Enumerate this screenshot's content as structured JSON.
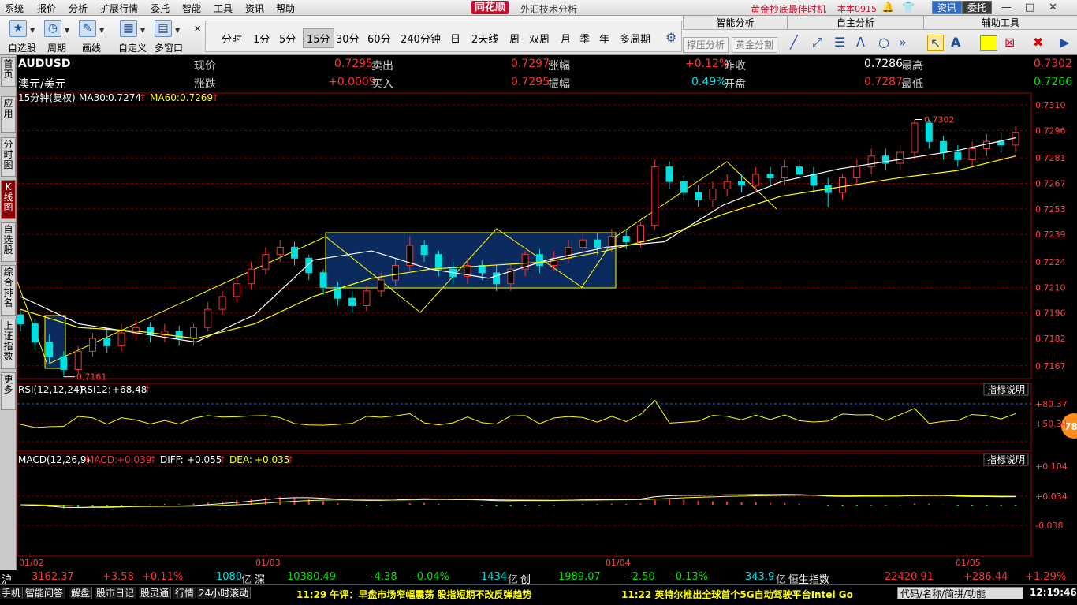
{
  "menu": {
    "items": [
      "系统",
      "报价",
      "分析",
      "扩展行情",
      "委托",
      "智能",
      "工具",
      "资讯",
      "帮助"
    ],
    "brand": "同花顺",
    "brand_sub": "外汇技术分析",
    "promo": "黄金抄底最佳时机",
    "user": "本本0915",
    "news_btn": "资讯",
    "trade_btn": "委托"
  },
  "toolbar": {
    "tools": [
      {
        "label": "自选股",
        "icon": "star"
      },
      {
        "label": "周期",
        "icon": "clock"
      },
      {
        "label": "画线",
        "icon": "pen"
      },
      {
        "label": "自定义",
        "icon": "grid"
      },
      {
        "label": "多窗口",
        "icon": "windows"
      }
    ],
    "periods": [
      "分时",
      "1分",
      "5分",
      "15分",
      "30分",
      "60分",
      "240分钟",
      "日",
      "2天线",
      "周",
      "双周",
      "月",
      "季",
      "年",
      "多周期"
    ],
    "active_period": "15分"
  },
  "right_panel": {
    "smart": "智能分析",
    "self": "自主分析",
    "aux": "辅助工具",
    "btn_support": "撑压分析",
    "btn_gold": "黄金分割"
  },
  "sidebar": {
    "tabs": [
      {
        "label": "首页",
        "active": false
      },
      {
        "label": "应用",
        "active": false
      },
      {
        "label": "分时图",
        "active": false
      },
      {
        "label": "K线图",
        "active": true
      },
      {
        "label": "自选股",
        "active": false
      },
      {
        "label": "综合排名",
        "active": false
      },
      {
        "label": "上证指数",
        "active": false
      },
      {
        "label": "更多",
        "active": false
      }
    ]
  },
  "quote": {
    "symbol": "AUDUSD",
    "name": "澳元/美元",
    "price_label": "现价",
    "price": "0.7295",
    "sell_label": "卖出",
    "sell": "0.7297",
    "pct_label": "涨幅",
    "pct": "+0.12%",
    "prev_label": "昨收",
    "prev": "0.7286",
    "high_label": "最高",
    "high": "0.7302",
    "chg_label": "涨跌",
    "chg": "+0.0009",
    "buy_label": "买入",
    "buy": "0.7295",
    "amp_label": "振幅",
    "amp": "0.49%",
    "open_label": "开盘",
    "open": "0.7287",
    "low_label": "最低",
    "low": "0.7266"
  },
  "main_chart": {
    "title": "15分钟(复权)",
    "ma30_label": "MA30:",
    "ma30": "0.7274",
    "ma60_label": "MA60:",
    "ma60": "0.7269",
    "high_mark": "0.7302",
    "low_mark": "0.7161",
    "yticks": [
      "0.7310",
      "0.7296",
      "0.7281",
      "0.7267",
      "0.7253",
      "0.7239",
      "0.7224",
      "0.7210",
      "0.7196",
      "0.7182",
      "0.7167"
    ]
  },
  "rsi": {
    "title": "RSI(12,12,24)",
    "label": "RSI12:",
    "value": "+68.48",
    "explain": "指标说明",
    "yticks": [
      "+80.37",
      "+50.34"
    ],
    "badge": "78"
  },
  "macd": {
    "title": "MACD(12,26,9)",
    "macd_label": "MACD:",
    "macd": "+0.039",
    "diff_label": "DIFF:",
    "diff": "+0.055",
    "dea_label": "DEA:",
    "dea": "+0.035",
    "explain": "指标说明",
    "yticks": [
      "+0.104",
      "+0.034",
      "-0.038"
    ]
  },
  "dates": [
    "01/02",
    "01/03",
    "01/04",
    "01/05"
  ],
  "market": {
    "sh_label": "沪",
    "sh": "3162.37",
    "sh_chg": "+3.58",
    "sh_pct": "+0.11%",
    "sh_amt": "1080",
    "unit1": "亿",
    "sz_label": "深",
    "sz": "10380.49",
    "sz_chg": "-4.38",
    "sz_pct": "-0.04%",
    "sz_amt": "1434",
    "unit2": "亿",
    "cy_label": "创",
    "cy": "1989.07",
    "cy_chg": "-2.50",
    "cy_pct": "-0.13%",
    "cy_amt": "343.9",
    "unit3": "亿",
    "hs_label": "恒生指数",
    "hs": "22420.91",
    "hs_chg": "+286.44",
    "hs_pct": "+1.29%"
  },
  "bottom": {
    "tabs": [
      "手机",
      "智能问答",
      "解盘",
      "股市日记",
      "股灵通",
      "行情",
      "24小时滚动"
    ],
    "news1": "11:29 午评：早盘市场窄幅震荡 股指短期不改反弹趋势",
    "news2": "11:22 英特尔推出全球首个5G自动驾驶平台Intel Go",
    "search": "代码/名称/简拼/功能",
    "clock": "12:19:46"
  },
  "colors": {
    "up": "#ff3232",
    "down": "#00e0e0",
    "ma_white": "#ffffff",
    "ma_yellow": "#ffff00",
    "box_fill": "#0b2a5e",
    "grid": "#7a0000"
  },
  "chart_data": {
    "type": "candlestick",
    "x_labels": [
      "01/02",
      "01/03",
      "01/04",
      "01/05"
    ],
    "ylim": [
      0.716,
      0.731
    ],
    "series": [
      {
        "name": "MA30",
        "values": [
          0.7205,
          0.719,
          0.7185,
          0.718,
          0.7195,
          0.7225,
          0.723,
          0.722,
          0.7215,
          0.7225,
          0.7232,
          0.7235,
          0.7255,
          0.7268,
          0.7275,
          0.728,
          0.7285,
          0.7292
        ]
      },
      {
        "name": "MA60",
        "values": [
          0.7198,
          0.7188,
          0.7186,
          0.7182,
          0.719,
          0.7205,
          0.7215,
          0.722,
          0.7222,
          0.7224,
          0.723,
          0.7238,
          0.725,
          0.726,
          0.7265,
          0.727,
          0.7274,
          0.7282
        ]
      }
    ],
    "candles": [
      [
        0.7195,
        0.719,
        0.7198,
        0.7186
      ],
      [
        0.719,
        0.718,
        0.7193,
        0.7176
      ],
      [
        0.718,
        0.7172,
        0.7184,
        0.7168
      ],
      [
        0.7172,
        0.7165,
        0.7175,
        0.7161
      ],
      [
        0.7165,
        0.7175,
        0.7178,
        0.7163
      ],
      [
        0.7175,
        0.7182,
        0.7185,
        0.7172
      ],
      [
        0.7182,
        0.7178,
        0.7188,
        0.7174
      ],
      [
        0.7178,
        0.7185,
        0.719,
        0.7175
      ],
      [
        0.7185,
        0.7188,
        0.7192,
        0.7182
      ],
      [
        0.7188,
        0.7184,
        0.7191,
        0.718
      ],
      [
        0.7184,
        0.7186,
        0.719,
        0.718
      ],
      [
        0.7186,
        0.7182,
        0.7189,
        0.7178
      ],
      [
        0.7182,
        0.7188,
        0.719,
        0.7178
      ],
      [
        0.7188,
        0.7198,
        0.7202,
        0.7186
      ],
      [
        0.7198,
        0.7205,
        0.7208,
        0.7195
      ],
      [
        0.7205,
        0.7212,
        0.7215,
        0.7202
      ],
      [
        0.7212,
        0.722,
        0.7224,
        0.7209
      ],
      [
        0.722,
        0.7228,
        0.7232,
        0.7217
      ],
      [
        0.7228,
        0.7232,
        0.7236,
        0.7224
      ],
      [
        0.7232,
        0.7226,
        0.7235,
        0.7222
      ],
      [
        0.7226,
        0.7218,
        0.7228,
        0.7214
      ],
      [
        0.7218,
        0.721,
        0.722,
        0.7206
      ],
      [
        0.721,
        0.7204,
        0.7213,
        0.72
      ],
      [
        0.7204,
        0.72,
        0.7208,
        0.7196
      ],
      [
        0.72,
        0.7208,
        0.7211,
        0.7197
      ],
      [
        0.7208,
        0.7214,
        0.7218,
        0.7205
      ],
      [
        0.7214,
        0.7222,
        0.7226,
        0.7211
      ],
      [
        0.7222,
        0.7233,
        0.7238,
        0.7219
      ],
      [
        0.7233,
        0.7228,
        0.7236,
        0.7224
      ],
      [
        0.7228,
        0.722,
        0.723,
        0.7216
      ],
      [
        0.722,
        0.7216,
        0.7224,
        0.7212
      ],
      [
        0.7216,
        0.7222,
        0.7226,
        0.7212
      ],
      [
        0.7222,
        0.7218,
        0.7225,
        0.7214
      ],
      [
        0.7218,
        0.7212,
        0.7222,
        0.7208
      ],
      [
        0.7212,
        0.722,
        0.7223,
        0.7208
      ],
      [
        0.722,
        0.7228,
        0.723,
        0.7216
      ],
      [
        0.7228,
        0.7222,
        0.7231,
        0.7218
      ],
      [
        0.7222,
        0.7226,
        0.723,
        0.7219
      ],
      [
        0.7226,
        0.7232,
        0.7236,
        0.7223
      ],
      [
        0.7232,
        0.7236,
        0.724,
        0.7229
      ],
      [
        0.7236,
        0.7232,
        0.724,
        0.7228
      ],
      [
        0.7232,
        0.7238,
        0.7242,
        0.7229
      ],
      [
        0.7238,
        0.7235,
        0.7242,
        0.7231
      ],
      [
        0.7235,
        0.7244,
        0.7246,
        0.7232
      ],
      [
        0.7244,
        0.7276,
        0.728,
        0.7242
      ],
      [
        0.7276,
        0.7268,
        0.7279,
        0.7264
      ],
      [
        0.7268,
        0.7262,
        0.7271,
        0.7258
      ],
      [
        0.7262,
        0.7258,
        0.7266,
        0.7254
      ],
      [
        0.7258,
        0.7264,
        0.7268,
        0.7254
      ],
      [
        0.7264,
        0.7268,
        0.7272,
        0.726
      ],
      [
        0.7268,
        0.7266,
        0.7272,
        0.7262
      ],
      [
        0.7266,
        0.7272,
        0.7276,
        0.7262
      ],
      [
        0.7272,
        0.727,
        0.7276,
        0.7266
      ],
      [
        0.727,
        0.7276,
        0.728,
        0.7266
      ],
      [
        0.7276,
        0.7272,
        0.728,
        0.7268
      ],
      [
        0.7272,
        0.7266,
        0.7276,
        0.7262
      ],
      [
        0.7266,
        0.7262,
        0.727,
        0.7254
      ],
      [
        0.7262,
        0.727,
        0.7272,
        0.7258
      ],
      [
        0.727,
        0.7276,
        0.728,
        0.7266
      ],
      [
        0.7276,
        0.7282,
        0.7286,
        0.7272
      ],
      [
        0.7282,
        0.7278,
        0.7286,
        0.7274
      ],
      [
        0.7278,
        0.7284,
        0.7288,
        0.7274
      ],
      [
        0.7284,
        0.73,
        0.7302,
        0.728
      ],
      [
        0.73,
        0.729,
        0.7302,
        0.7286
      ],
      [
        0.729,
        0.7284,
        0.7293,
        0.728
      ],
      [
        0.7284,
        0.728,
        0.7288,
        0.7276
      ],
      [
        0.728,
        0.7286,
        0.729,
        0.7276
      ],
      [
        0.7286,
        0.729,
        0.7294,
        0.7282
      ],
      [
        0.729,
        0.7288,
        0.7295,
        0.7284
      ],
      [
        0.7288,
        0.7295,
        0.7298,
        0.7284
      ]
    ]
  }
}
